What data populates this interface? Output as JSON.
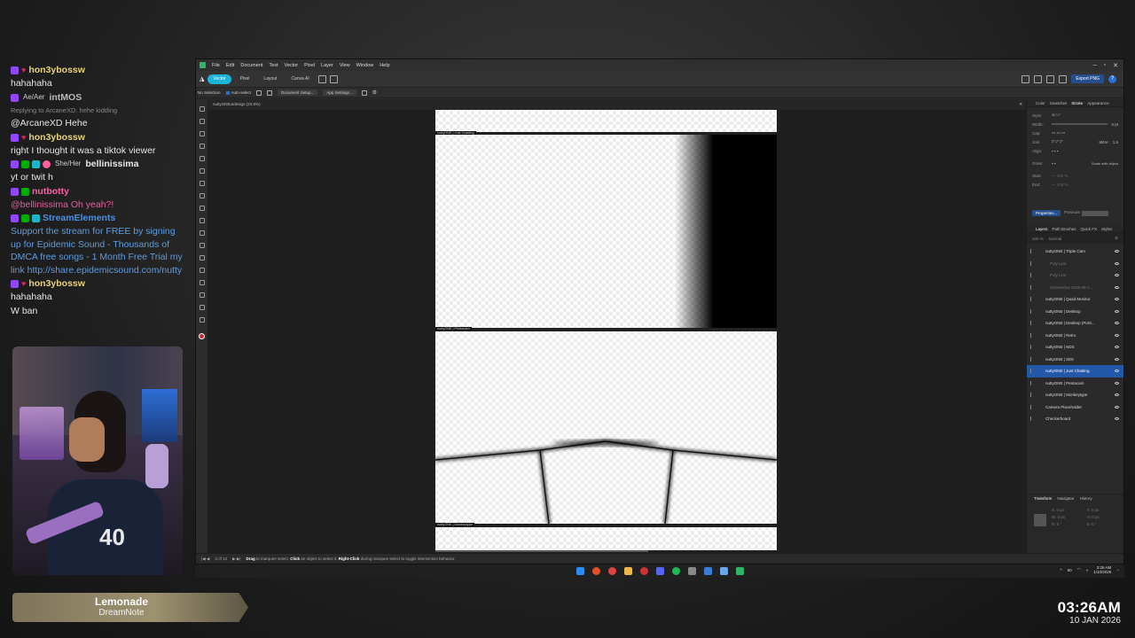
{
  "chat": [
    {
      "user": "hon3ybossw",
      "user_color": "#e8d27a",
      "badges": [
        "purple",
        "heart"
      ],
      "text": "hahahaha"
    },
    {
      "user": "intMOS",
      "user_color": "#b9b9b9",
      "pronoun": "Ae/Aer",
      "badges": [
        "purple"
      ],
      "reply": "Replying to ArcaneXD: hehe kidding",
      "text": "@ArcaneXD Hehe"
    },
    {
      "user": "hon3ybossw",
      "user_color": "#e8d27a",
      "badges": [
        "purple",
        "heart"
      ],
      "text": "right I thought it was a tiktok viewer"
    },
    {
      "user": "bellinissima",
      "user_color": "#e8e8e8",
      "pronoun": "She/Her",
      "badges": [
        "purple",
        "green",
        "teal",
        "pink"
      ],
      "text": "yt or twit h"
    },
    {
      "user": "nutbotty",
      "user_color": "#ff5ea0",
      "badges": [
        "purple",
        "green"
      ],
      "text": "@bellinissima Oh yeah?!",
      "text_color": "#e35e9e"
    },
    {
      "user": "StreamElements",
      "user_color": "#4a90e2",
      "badges": [
        "purple",
        "green",
        "teal"
      ],
      "text": "Support the stream for FREE by signing up for Epidemic Sound - Thousands of DMCA free songs - 1 Month Free Trial my link http://share.epidemicsound.com/nutty",
      "text_color": "#5d9ce0"
    },
    {
      "user": "hon3ybossw",
      "user_color": "#e8d27a",
      "badges": [
        "purple",
        "heart"
      ],
      "text": "hahahaha"
    },
    {
      "user": "",
      "badges": [],
      "text": "W ban"
    }
  ],
  "webcam": {
    "jersey_number": "40"
  },
  "now_playing": {
    "title": "Lemonade",
    "artist": "DreamNote"
  },
  "clock": {
    "time": "03:26AM",
    "date": "10 JAN 2026"
  },
  "app": {
    "menu": [
      "File",
      "Edit",
      "Document",
      "Text",
      "Vector",
      "Pixel",
      "Layer",
      "View",
      "Window",
      "Help"
    ],
    "personas": [
      "Vector",
      "Pixel",
      "Layout",
      "Canva AI"
    ],
    "export_label": "Export PNG",
    "context": {
      "selection": "No Selection",
      "auto_select": "Auto-select",
      "doc_setup": "Document Setup...",
      "app_settings": "App Settings..."
    },
    "doc_tab": "nuttyONEuIdesign (24.9%)",
    "artboard_labels": [
      "nuttyONE | Just Chatting",
      "nuttyONE | Pentacam",
      "nuttyONE | Monkeytype"
    ],
    "right_tabs": [
      "Color",
      "Swatches",
      "Stroke",
      "Appearance"
    ],
    "stroke_labels": [
      "Style:",
      "Width:",
      "Cap:",
      "Join:",
      "Align:",
      "Order:",
      "Start:",
      "End:"
    ],
    "stroke_width_value": "0 pt",
    "mitre_label": "Mitre:",
    "mitre_value": "1.5",
    "scale_label": "Scale with object",
    "properties_btn": "Properties...",
    "pressure_label": "Pressure",
    "layer_tabs": [
      "Layers",
      "Path Brushes",
      "Quick FX",
      "Styles"
    ],
    "layer_opacity": "100 %",
    "blend_mode": "Normal",
    "layers": [
      {
        "name": "nuttyONE | Triple Cam",
        "state": "normal"
      },
      {
        "name": "Poly Line",
        "state": "dim"
      },
      {
        "name": "Poly Line",
        "state": "dim"
      },
      {
        "name": "Screenshot 2025-08-1...",
        "state": "dim"
      },
      {
        "name": "nuttyONE | Quad Monitor",
        "state": "normal"
      },
      {
        "name": "nuttyONE | Desktop",
        "state": "normal"
      },
      {
        "name": "nuttyONE | Desktop (Portr...",
        "state": "normal"
      },
      {
        "name": "nuttyONE | Retro",
        "state": "normal"
      },
      {
        "name": "nuttyONE | NDS",
        "state": "normal"
      },
      {
        "name": "nuttyONE | 3DS",
        "state": "normal"
      },
      {
        "name": "nuttyONE | Just Chatting",
        "state": "selected"
      },
      {
        "name": "nuttyONE | Pentacam",
        "state": "normal"
      },
      {
        "name": "nuttyONE | Monkeytype",
        "state": "normal"
      },
      {
        "name": "Camera Placeholder",
        "state": "normal"
      },
      {
        "name": "Checkerboard",
        "state": "normal"
      }
    ],
    "transform_tabs": [
      "Transform",
      "Navigator",
      "History"
    ],
    "transform_fields": [
      "X: 0 px",
      "Y: 0 px",
      "W: 0 px",
      "H: 0 px",
      "R: 0 °",
      "S: 0 °"
    ],
    "status": {
      "pages": "3 of 12",
      "hint_drag": "Drag",
      "hint1": "to marquee select.",
      "hint_click": "Click",
      "hint2": "an object to select it.",
      "hint_rclick": "Right-Click",
      "hint3": "during marquee select to toggle intersection behavior."
    }
  },
  "taskbar": {
    "time": "3:26 AM",
    "date": "1/10/2026",
    "indicator": "60"
  }
}
